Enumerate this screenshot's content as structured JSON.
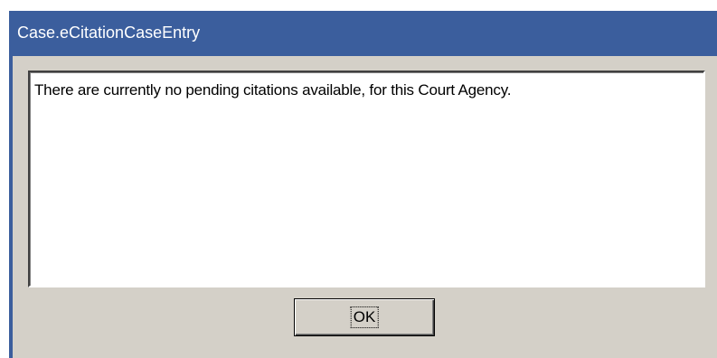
{
  "window": {
    "title": "Case.eCitationCaseEntry"
  },
  "dialog": {
    "message": "There are currently no pending citations available, for this Court Agency.",
    "ok_label": "OK"
  },
  "colors": {
    "titlebar": "#3b5e9d",
    "dialog_background": "#d4d0c8",
    "message_background": "#ffffff"
  }
}
